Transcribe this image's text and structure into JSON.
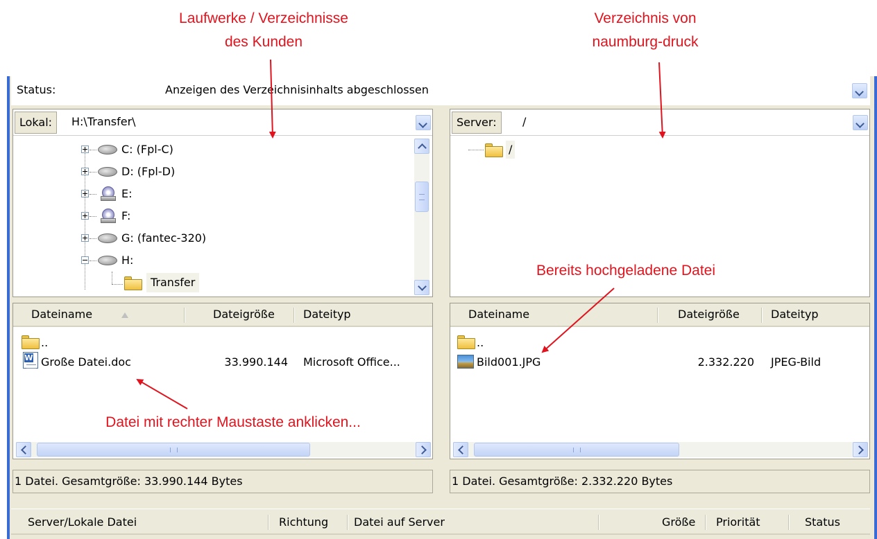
{
  "annotations": {
    "left_title_line1": "Laufwerke / Verzeichnisse",
    "left_title_line2": "des Kunden",
    "right_title_line1": "Verzeichnis von",
    "right_title_line2": "naumburg-druck",
    "uploaded_file": "Bereits hochgeladene Datei",
    "right_click_hint": "Datei mit rechter Maustaste anklicken..."
  },
  "status_log": {
    "label": "Status:",
    "message": "Anzeigen des Verzeichnisinhalts abgeschlossen"
  },
  "local": {
    "label": "Lokal:",
    "path": "H:\\Transfer\\",
    "tree": [
      {
        "label": "C: (Fpl-C)",
        "icon": "hard-drive-icon",
        "expander": "plus"
      },
      {
        "label": "D: (Fpl-D)",
        "icon": "hard-drive-icon",
        "expander": "plus"
      },
      {
        "label": "E:",
        "icon": "cd-drive-icon",
        "expander": "plus"
      },
      {
        "label": "F:",
        "icon": "cd-drive-icon",
        "expander": "plus"
      },
      {
        "label": "G: (fantec-320)",
        "icon": "hard-drive-icon",
        "expander": "plus"
      },
      {
        "label": "H:",
        "icon": "hard-drive-icon",
        "expander": "minus"
      },
      {
        "label": "Transfer",
        "icon": "folder-icon",
        "expander": "none"
      }
    ],
    "columns": {
      "name": "Dateiname",
      "size": "Dateigröße",
      "type": "Dateityp"
    },
    "files": [
      {
        "name": "..",
        "size": "",
        "type": "",
        "icon": "folder-icon"
      },
      {
        "name": "Große Datei.doc",
        "size": "33.990.144",
        "type": "Microsoft Office...",
        "icon": "word-document-icon"
      }
    ],
    "scroll_glyph": "III",
    "summary": "1 Datei. Gesamtgröße: 33.990.144 Bytes"
  },
  "remote": {
    "label": "Server:",
    "path": "/",
    "tree": [
      {
        "label": "/",
        "icon": "folder-icon"
      }
    ],
    "columns": {
      "name": "Dateiname",
      "size": "Dateigröße",
      "type": "Dateityp"
    },
    "files": [
      {
        "name": "..",
        "size": "",
        "type": "",
        "icon": "folder-icon"
      },
      {
        "name": "Bild001.JPG",
        "size": "2.332.220",
        "type": "JPEG-Bild",
        "icon": "image-file-icon"
      }
    ],
    "scroll_glyph": "III",
    "summary": "1 Datei. Gesamtgröße: 2.332.220 Bytes"
  },
  "queue": {
    "columns": [
      "Server/Lokale Datei",
      "Richtung",
      "Datei auf Server",
      "Größe",
      "Priorität",
      "Status"
    ]
  },
  "colors": {
    "annotation": "#e0141e",
    "window_border": "#3a6ad4",
    "panel_bg": "#ece9d8",
    "selection": "#f2f2e8"
  }
}
